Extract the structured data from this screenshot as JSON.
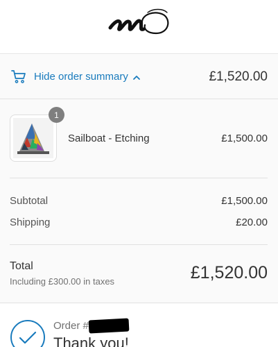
{
  "header": {
    "logo_icon": "handwritten-signature-logo"
  },
  "summary_toggle": {
    "cart_icon": "cart-icon",
    "label": "Hide order summary",
    "caret_icon": "chevron-up-icon",
    "total": "£1,520.00"
  },
  "order_summary": {
    "products": [
      {
        "quantity": "1",
        "name": "Sailboat - Etching",
        "price": "£1,500.00"
      }
    ],
    "subtotal_label": "Subtotal",
    "subtotal_value": "£1,500.00",
    "shipping_label": "Shipping",
    "shipping_value": "£20.00",
    "total_label": "Total",
    "tax_note": "Including £300.00 in taxes",
    "total_value": "£1,520.00"
  },
  "confirmation": {
    "icon": "checkmark-circle-icon",
    "order_prefix": "Order #",
    "title": "Thank you!"
  },
  "colors": {
    "accent": "#197bbd",
    "badge": "#7f7f7f",
    "muted": "#717171"
  }
}
